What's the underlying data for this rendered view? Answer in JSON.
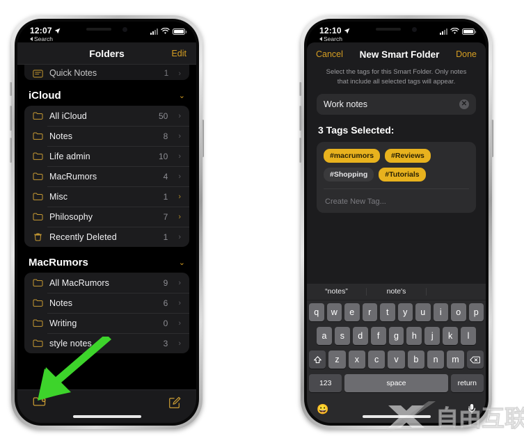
{
  "left_phone": {
    "status": {
      "time": "12:07",
      "back_label": "Search"
    },
    "nav": {
      "title": "Folders",
      "edit_label": "Edit"
    },
    "clipped_row": {
      "label": "Quick Notes",
      "count": "1",
      "chevron": "›",
      "icon": "quick-notes-icon"
    },
    "sections": [
      {
        "title": "iCloud",
        "chevron": "⌄",
        "rows": [
          {
            "label": "All iCloud",
            "count": "50",
            "icon": "folder-icon",
            "chevron": "›"
          },
          {
            "label": "Notes",
            "count": "8",
            "icon": "folder-icon",
            "chevron": "›"
          },
          {
            "label": "Life admin",
            "count": "10",
            "icon": "folder-icon",
            "chevron": "›"
          },
          {
            "label": "MacRumors",
            "count": "4",
            "icon": "folder-icon",
            "chevron": "›"
          },
          {
            "label": "Misc",
            "count": "1",
            "icon": "folder-icon",
            "chevron": "›"
          },
          {
            "label": "Philosophy",
            "count": "7",
            "icon": "folder-icon",
            "chevron": "›"
          },
          {
            "label": "Recently Deleted",
            "count": "1",
            "icon": "trash-icon",
            "chevron": "›"
          }
        ]
      },
      {
        "title": "MacRumors",
        "chevron": "⌄",
        "rows": [
          {
            "label": "All MacRumors",
            "count": "9",
            "icon": "folder-icon",
            "chevron": "›"
          },
          {
            "label": "Notes",
            "count": "6",
            "icon": "folder-icon",
            "chevron": "›"
          },
          {
            "label": "Writing",
            "count": "0",
            "icon": "folder-icon",
            "chevron": "›"
          },
          {
            "label": "style notes",
            "count": "3",
            "icon": "folder-icon",
            "chevron": "›"
          }
        ]
      }
    ],
    "toolbar": {
      "new_folder_icon": "new-folder-icon",
      "compose_icon": "compose-icon"
    }
  },
  "right_phone": {
    "status": {
      "time": "12:10",
      "back_label": "Search"
    },
    "nav": {
      "cancel_label": "Cancel",
      "title": "New Smart Folder",
      "done_label": "Done"
    },
    "description": "Select the tags for this Smart Folder. Only notes that include all selected tags will appear.",
    "name_field": {
      "value": "Work notes",
      "clear_icon": "clear-icon"
    },
    "tags_title": "3 Tags Selected:",
    "tags": [
      {
        "label": "#macrumors",
        "selected": true
      },
      {
        "label": "#Reviews",
        "selected": true
      },
      {
        "label": "#Shopping",
        "selected": false
      },
      {
        "label": "#Tutorials",
        "selected": true
      }
    ],
    "create_tag_placeholder": "Create New Tag...",
    "keyboard": {
      "predictions": [
        "“notes”",
        "note's",
        ""
      ],
      "row1": [
        "q",
        "w",
        "e",
        "r",
        "t",
        "y",
        "u",
        "i",
        "o",
        "p"
      ],
      "row2": [
        "a",
        "s",
        "d",
        "f",
        "g",
        "h",
        "j",
        "k",
        "l"
      ],
      "row3": [
        "z",
        "x",
        "c",
        "v",
        "b",
        "n",
        "m"
      ],
      "shift_icon": "shift-icon",
      "backspace_icon": "backspace-icon",
      "numbers_label": "123",
      "space_label": "space",
      "return_label": "return",
      "emoji_icon": "emoji-icon",
      "mic_icon": "microphone-icon"
    }
  },
  "annotation": {
    "arrow_color": "#3dd42b",
    "points_to": "new-folder-button"
  },
  "watermark": {
    "text": "自由互联",
    "mark": "X"
  },
  "colors": {
    "accent": "#d79f22",
    "tag_selected": "#e8b21e",
    "background": "#000000",
    "surface": "#1c1c1e"
  }
}
